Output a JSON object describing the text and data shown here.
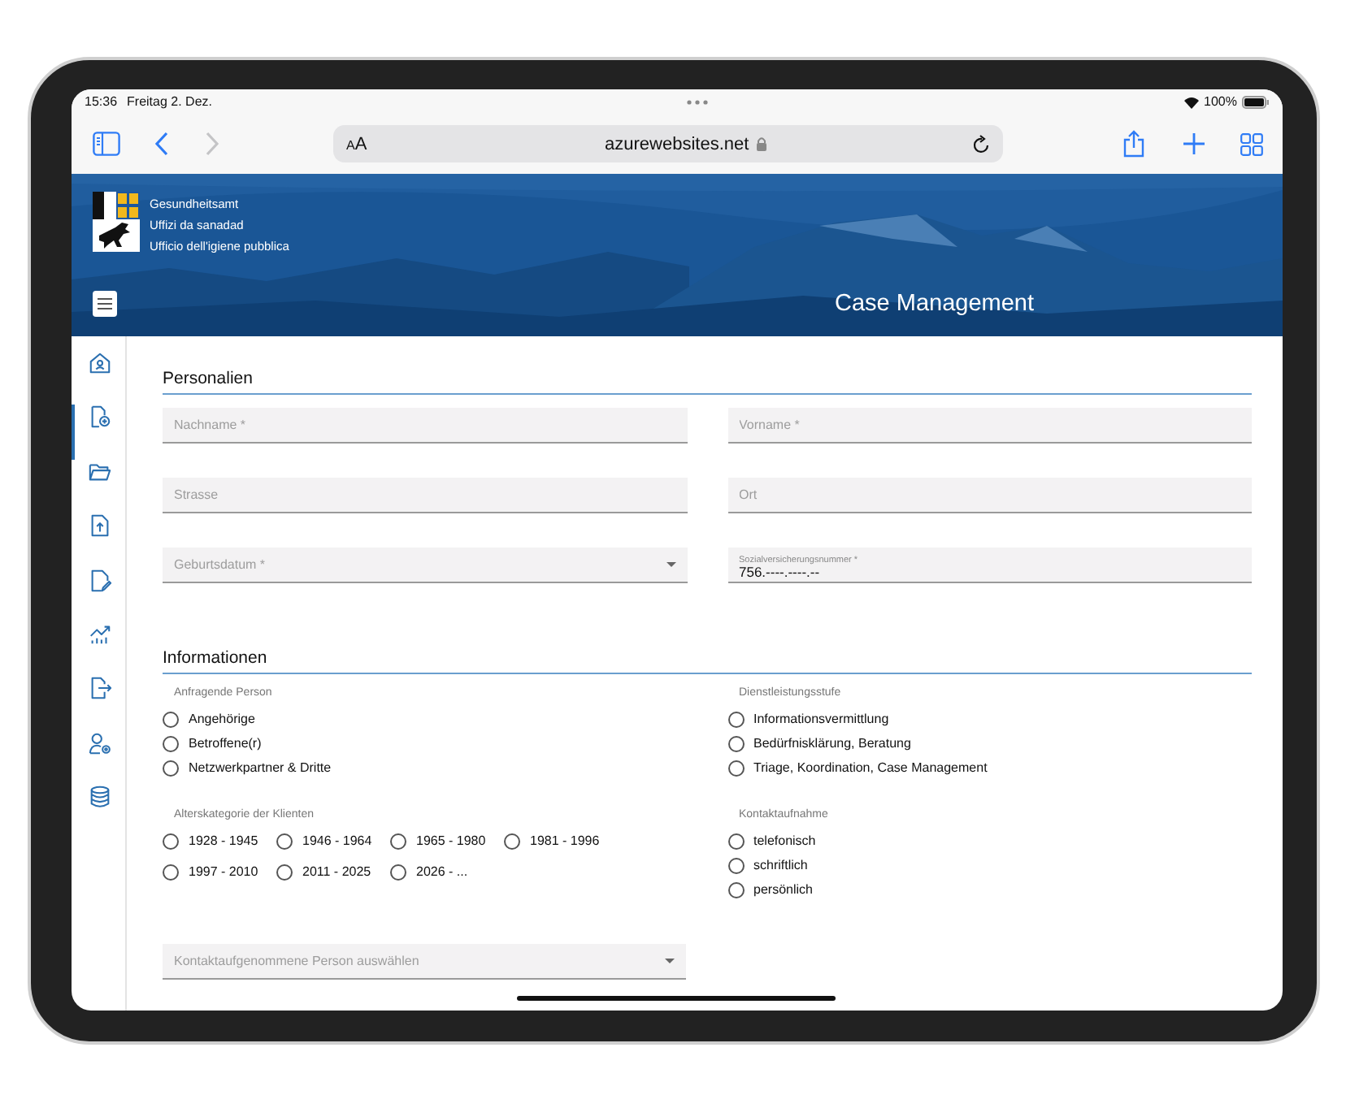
{
  "status_bar": {
    "time": "15:36",
    "date": "Freitag 2. Dez.",
    "battery": "100%"
  },
  "browser": {
    "text_size": "AA",
    "url": "azurewebsites.net",
    "back": {
      "disabled": false
    },
    "forward": {
      "disabled": true
    }
  },
  "header": {
    "org_lines": [
      "Gesundheitsamt",
      "Uffizi da sanadad",
      "Ufficio dell'igiene pubblica"
    ],
    "title": "Case Management"
  },
  "sidebar": {
    "items": [
      {
        "kind": "home",
        "selected": false
      },
      {
        "kind": "file-add",
        "selected": true
      },
      {
        "kind": "folder",
        "selected": false
      },
      {
        "kind": "file-upload",
        "selected": false
      },
      {
        "kind": "file-edit",
        "selected": false
      },
      {
        "kind": "chart",
        "selected": false
      },
      {
        "kind": "file-export",
        "selected": false
      },
      {
        "kind": "user-settings",
        "selected": false
      },
      {
        "kind": "database",
        "selected": false
      }
    ]
  },
  "personalien": {
    "title": "Personalien",
    "fields": [
      {
        "kind": "text",
        "placeholder": "Nachname *"
      },
      {
        "kind": "text",
        "placeholder": "Vorname *"
      },
      {
        "kind": "text",
        "placeholder": "Strasse"
      },
      {
        "kind": "text",
        "placeholder": "Ort"
      },
      {
        "kind": "select",
        "placeholder": "Geburtsdatum *"
      },
      {
        "kind": "filled",
        "label": "Sozialversicherungsnummer *",
        "value": "756.----.----.--"
      }
    ]
  },
  "informationen": {
    "title": "Informationen",
    "groups": [
      {
        "label": "Anfragende Person",
        "kind": "list",
        "options": [
          {
            "label": "Angehörige",
            "selected": false
          },
          {
            "label": "Betroffene(r)",
            "selected": false
          },
          {
            "label": "Netzwerkpartner & Dritte",
            "selected": false
          }
        ]
      },
      {
        "label": "Dienstleistungsstufe",
        "kind": "list",
        "options": [
          {
            "label": "Informationsvermittlung",
            "selected": false
          },
          {
            "label": "Bedürfnisklärung, Beratung",
            "selected": false
          },
          {
            "label": "Triage, Koordination, Case Management",
            "selected": false
          }
        ]
      },
      {
        "label": "Alterskategorie der Klienten",
        "kind": "grid",
        "options": [
          {
            "label": "1928 - 1945",
            "selected": false
          },
          {
            "label": "1946 - 1964",
            "selected": false
          },
          {
            "label": "1965 - 1980",
            "selected": false
          },
          {
            "label": "1981 - 1996",
            "selected": false
          },
          {
            "label": "1997 - 2010",
            "selected": false
          },
          {
            "label": "2011 - 2025",
            "selected": false
          },
          {
            "label": "2026 - ...",
            "selected": false
          }
        ]
      },
      {
        "label": "Kontaktaufnahme",
        "kind": "list",
        "options": [
          {
            "label": "telefonisch",
            "selected": false
          },
          {
            "label": "schriftlich",
            "selected": false
          },
          {
            "label": "persönlich",
            "selected": false
          }
        ]
      }
    ],
    "contact_select": {
      "placeholder": "Kontaktaufgenommene Person auswählen"
    }
  }
}
